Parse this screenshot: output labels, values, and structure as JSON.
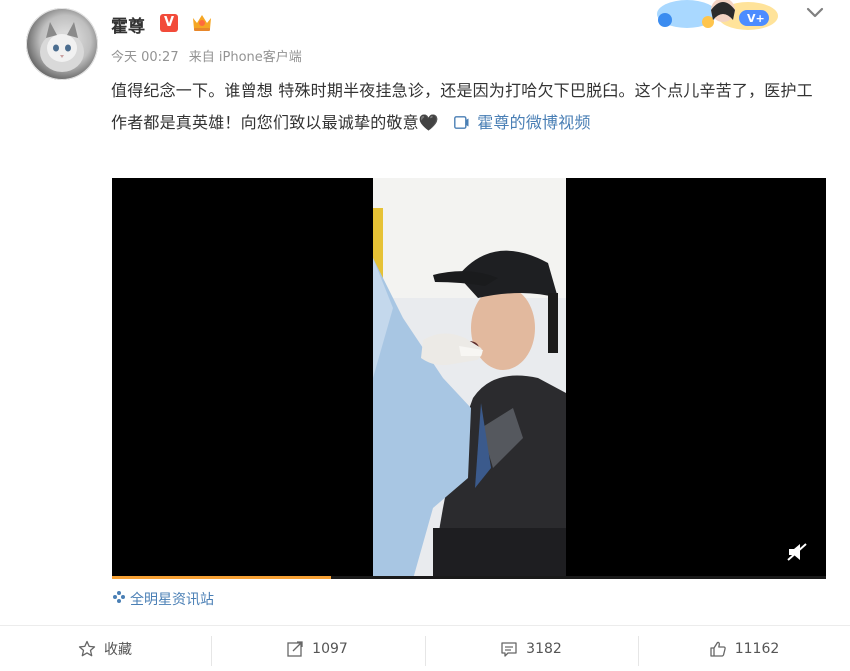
{
  "post": {
    "author": "霍尊",
    "verified_badge": "V",
    "time": "今天 00:27",
    "via": "来自 iPhone客户端",
    "text": "值得纪念一下。谁曾想 特殊时期半夜挂急诊，还是因为打哈欠下巴脱臼。这个点儿辛苦了，医护工作者都是真英雄！向您们致以最诚挚的敬意🖤",
    "video_link": "霍尊的微博视频",
    "source": "全明星资讯站"
  },
  "actions": {
    "favorite": "收藏",
    "repost_count": "1097",
    "comment_count": "3182",
    "like_count": "11162"
  },
  "video": {
    "progress_fraction": 0.307
  },
  "icons": {
    "verified": "v-badge-icon",
    "crown": "crown-icon",
    "collapse": "chevron-down-icon",
    "video_link": "video-icon",
    "mute": "mute-icon",
    "source": "pinwheel-icon",
    "favorite": "star-icon",
    "repost": "repost-icon",
    "comment": "comment-icon",
    "like": "thumbs-up-icon"
  },
  "colors": {
    "link": "#4a7fb5",
    "badge_red": "#f24b3a",
    "progress": "#f7a134"
  }
}
